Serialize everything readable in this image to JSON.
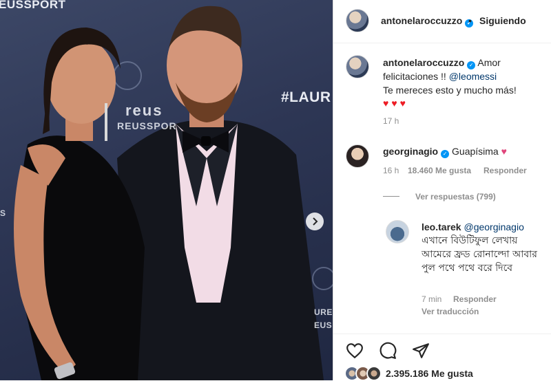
{
  "photo": {
    "brand_top": "EUSSPORT",
    "brand_hash": "#LAUR",
    "brand_mid1": "reus",
    "brand_mid2": "REUSSPOR",
    "brand_right1": "URE",
    "brand_right2": "EUS",
    "brand_left1": "S"
  },
  "header": {
    "username": "antonelaroccuzzo",
    "separator": "•",
    "follow_label": "Siguiendo"
  },
  "caption": {
    "username": "antonelaroccuzzo",
    "text_line1": "Amor",
    "text_line2": "felicitaciones !! ",
    "mention": "@leomessi",
    "text_line3": "Te mereces esto y mucho más!",
    "hearts": "♥♥♥",
    "time": "17 h"
  },
  "comment1": {
    "username": "georginagio",
    "text": "Guapísima",
    "emoji": "♥",
    "time": "16 h",
    "likes": "18.460 Me gusta",
    "reply_label": "Responder",
    "view_replies": "Ver respuestas (799)"
  },
  "comment2": {
    "username": "leo.tarek",
    "mention": "@georginagio",
    "text": "এখানে বিউটিফুল লেখায় আমেরে ফ্রড রোনাল্দো আবার পুল পথে পথে বরে দিবে",
    "time": "7 min",
    "reply_label": "Responder",
    "translate_label": "Ver traducción"
  },
  "footer": {
    "likes": "2.395.186 Me gusta"
  },
  "colors": {
    "verified": "#0095f6",
    "mention": "#00376b",
    "heart": "#ed1c24",
    "meta": "#8e8e8e"
  },
  "icons": [
    "heart-icon",
    "comment-icon",
    "share-icon",
    "chevron-right-icon",
    "verified-icon"
  ]
}
